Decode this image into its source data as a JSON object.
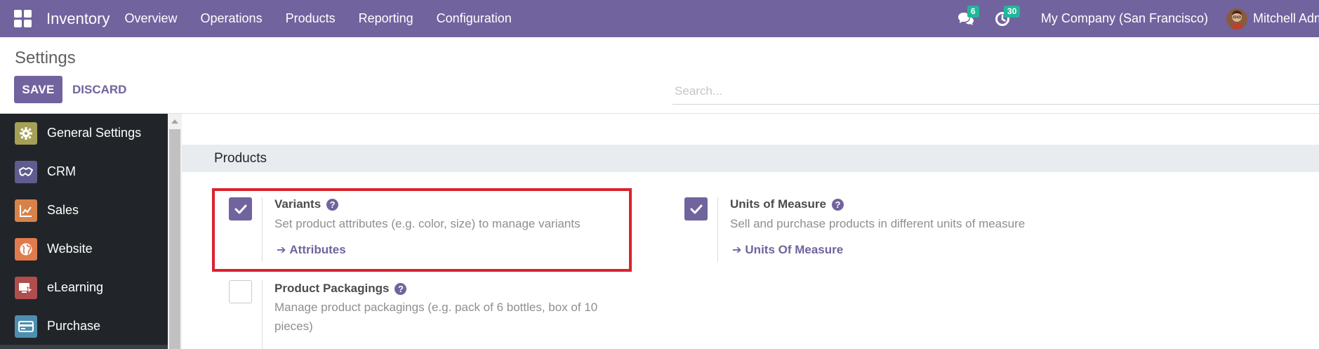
{
  "navbar": {
    "app_name": "Inventory",
    "menu": [
      "Overview",
      "Operations",
      "Products",
      "Reporting",
      "Configuration"
    ],
    "messages_badge": "6",
    "activities_badge": "30",
    "company": "My Company (San Francisco)",
    "user": "Mitchell Admin"
  },
  "control_panel": {
    "title": "Settings",
    "search_placeholder": "Search...",
    "save_label": "SAVE",
    "discard_label": "DISCARD"
  },
  "sidebar": {
    "items": [
      {
        "label": "General Settings",
        "icon": "gear-icon",
        "color": "#a4a156"
      },
      {
        "label": "CRM",
        "icon": "handshake-icon",
        "color": "#5f5c8f"
      },
      {
        "label": "Sales",
        "icon": "chart-icon",
        "color": "#d8824a"
      },
      {
        "label": "Website",
        "icon": "globe-icon",
        "color": "#e07b4c"
      },
      {
        "label": "eLearning",
        "icon": "elearning-icon",
        "color": "#b04d4d"
      },
      {
        "label": "Purchase",
        "icon": "card-icon",
        "color": "#4e8fb0"
      }
    ]
  },
  "section": {
    "title": "Products",
    "settings": [
      {
        "title": "Variants",
        "description": "Set product attributes (e.g. color, size) to manage variants",
        "link": "Attributes",
        "checked": true
      },
      {
        "title": "Units of Measure",
        "description": "Sell and purchase products in different units of measure",
        "link": "Units Of Measure",
        "checked": true
      },
      {
        "title": "Product Packagings",
        "description_line1": "Manage product packagings (e.g. pack of 6 bottles, box of 10",
        "description_line2": "pieces)",
        "checked": false
      }
    ]
  },
  "colors": {
    "primary": "#71639e",
    "highlight": "#d9232e",
    "badge": "#21b799"
  }
}
